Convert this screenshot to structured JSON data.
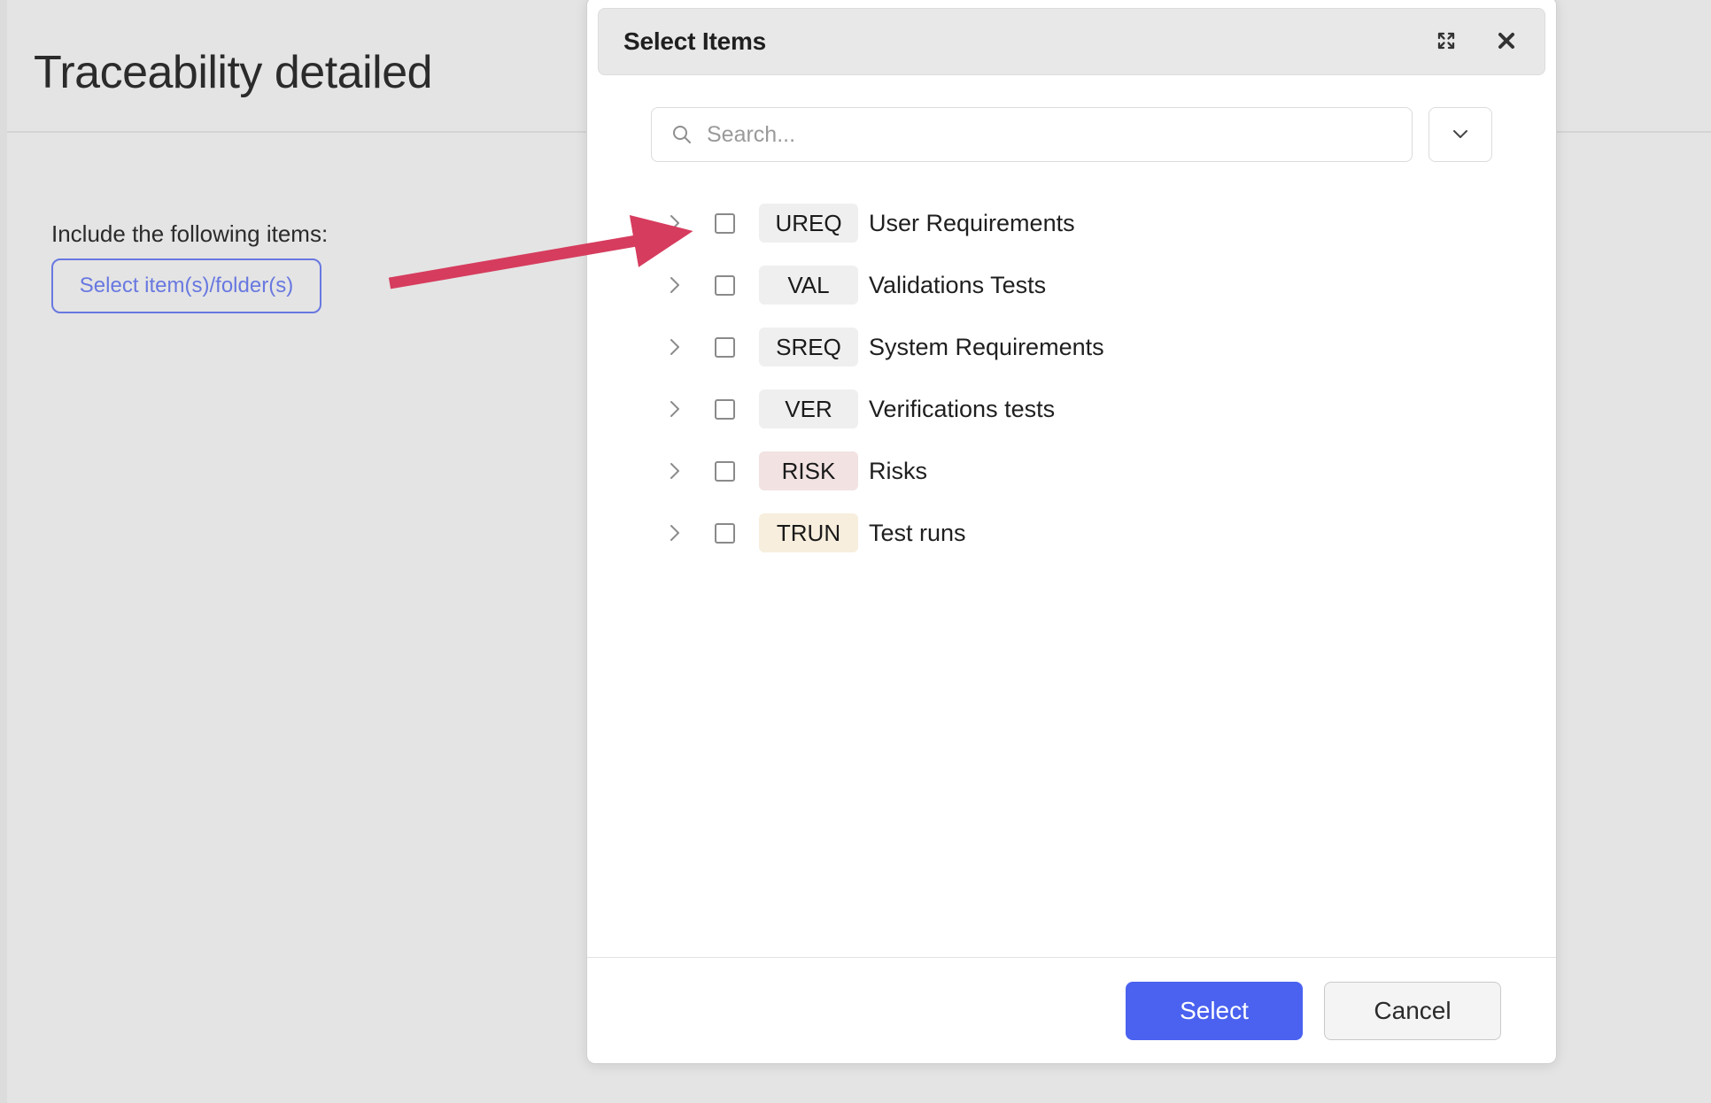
{
  "page": {
    "title": "Traceability detailed",
    "include_label": "Include the following items:",
    "select_button_label": "Select item(s)/folder(s)"
  },
  "annotation": {
    "type": "arrow",
    "color": "#d63c5e",
    "points_to": "expand-chevron-of-first-row"
  },
  "modal": {
    "title": "Select Items",
    "maximize_icon": "expand-icon",
    "close_icon": "close-icon",
    "search": {
      "placeholder": "Search...",
      "value": "",
      "icon": "search-icon"
    },
    "dropdown_toggle_icon": "chevron-down-icon",
    "items": [
      {
        "code": "UREQ",
        "label": "User Requirements",
        "badge_color": "#efefef",
        "checked": false,
        "expanded": false
      },
      {
        "code": "VAL",
        "label": "Validations Tests",
        "badge_color": "#efefef",
        "checked": false,
        "expanded": false
      },
      {
        "code": "SREQ",
        "label": "System Requirements",
        "badge_color": "#efefef",
        "checked": false,
        "expanded": false
      },
      {
        "code": "VER",
        "label": "Verifications tests",
        "badge_color": "#efefef",
        "checked": false,
        "expanded": false
      },
      {
        "code": "RISK",
        "label": "Risks",
        "badge_color": "#f2e2e2",
        "checked": false,
        "expanded": false
      },
      {
        "code": "TRUN",
        "label": "Test runs",
        "badge_color": "#f7eedd",
        "checked": false,
        "expanded": false
      }
    ],
    "footer": {
      "select_label": "Select",
      "cancel_label": "Cancel",
      "primary_color": "#4a62ef"
    }
  }
}
